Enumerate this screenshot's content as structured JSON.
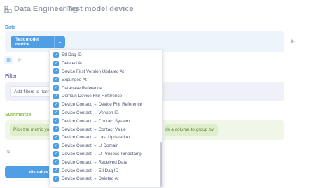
{
  "header": {
    "database": "Data Engineering",
    "separator": "/",
    "model": "Test model device"
  },
  "data_section": {
    "label": "Data",
    "table_button": "Test model device"
  },
  "filter_section": {
    "label": "Filter",
    "add_filter_button": "Add filters to narrow"
  },
  "summarize_section": {
    "label": "Summarize",
    "metric_button": "Pick the metric you",
    "group_button": "ick a column to group by"
  },
  "visualize_button": "Visualize",
  "column_dropdown": {
    "items": [
      "Etl Dag ID",
      "Deleted At",
      "Device First Version Updated At",
      "Expunged At",
      "Database Reference",
      "Domain Device Fhir Reference",
      "Device Contact → Device Fhir Reference",
      "Device Contact → Version ID",
      "Device Contact → Contact System",
      "Device Contact → Contact Value",
      "Device Contact → Last Updated At",
      "Device Contact → Lf Domain",
      "Device Contact → Lf Process Timestamp",
      "Device Contact → Received Date",
      "Device Contact → Etl Dag ID",
      "Device Contact → Deleted At"
    ]
  },
  "colors": {
    "brand": "#509ee3",
    "filter": "#7172ad",
    "summarize": "#88bf4d"
  }
}
